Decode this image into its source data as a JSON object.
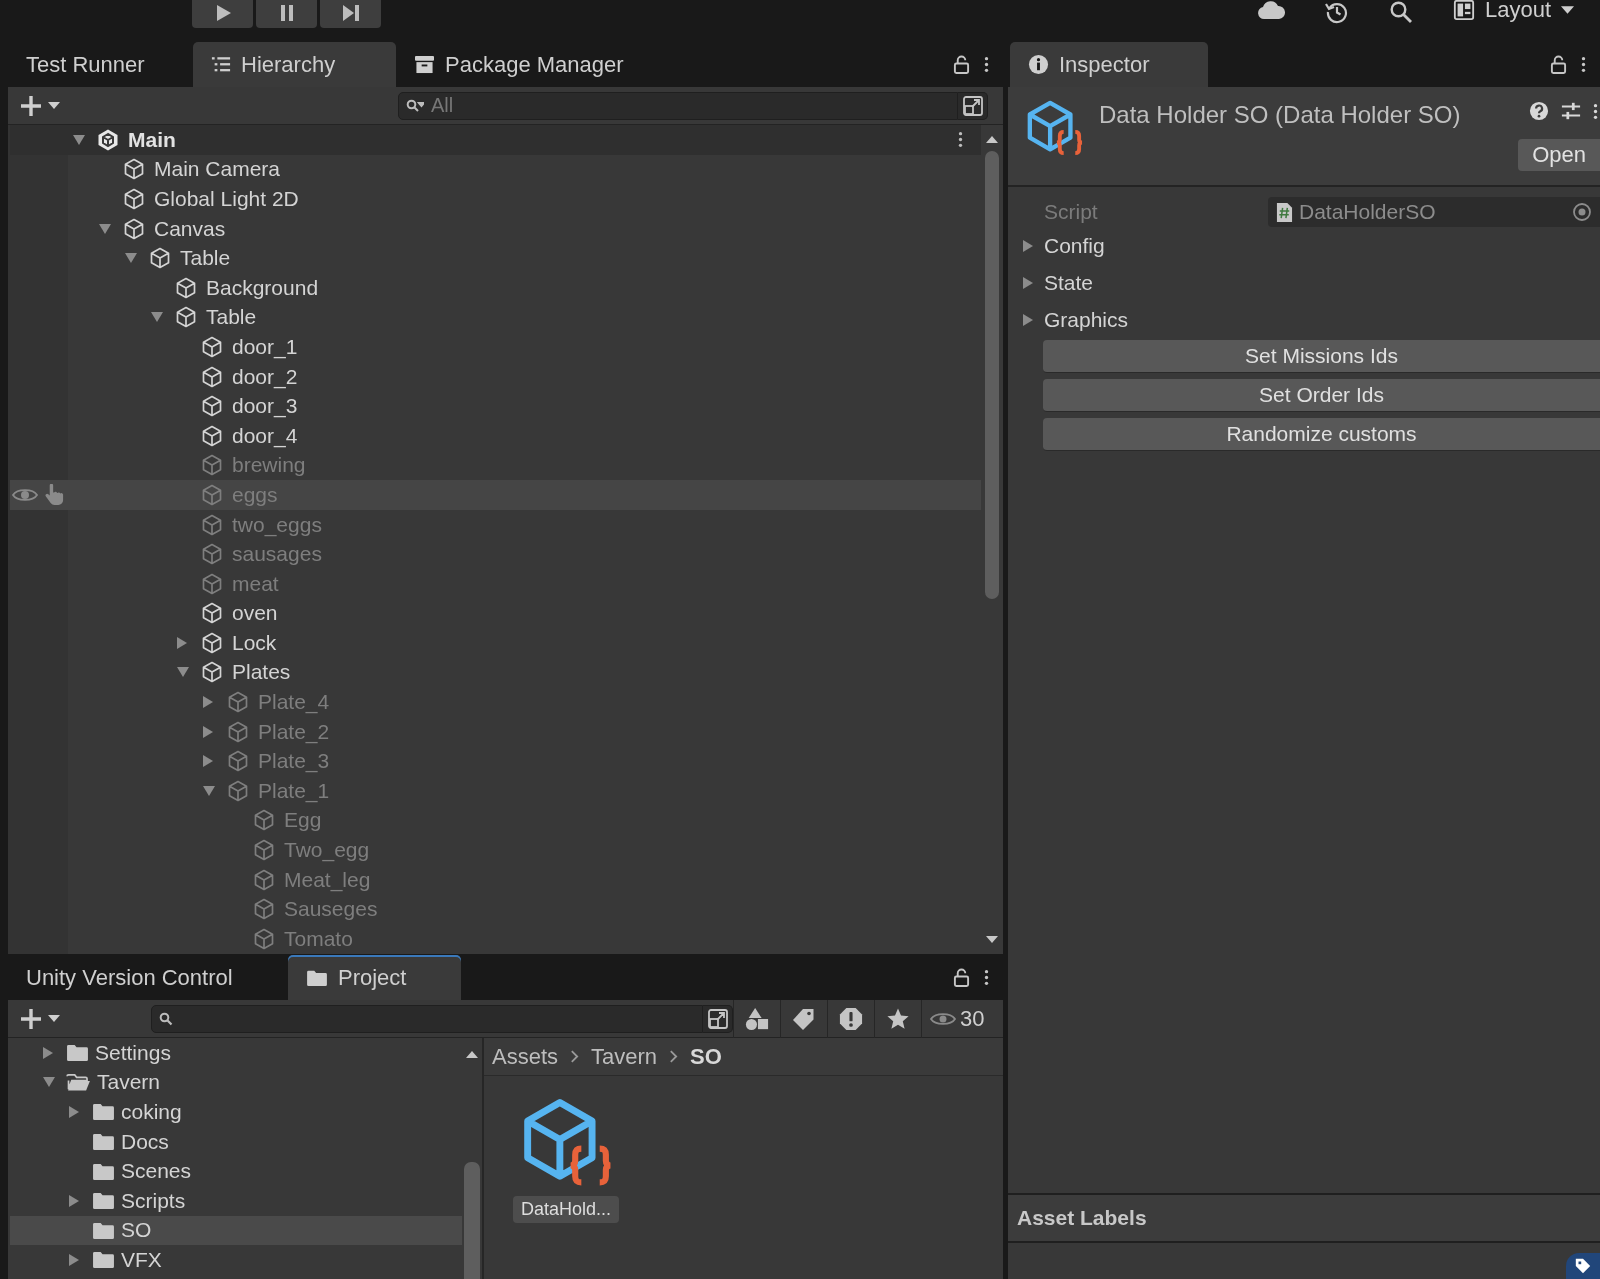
{
  "top_bar": {
    "layout_button": "Layout"
  },
  "hierarchy_panel": {
    "tabs": [
      {
        "label": "Test Runner",
        "kind": "plain",
        "selected": false
      },
      {
        "label": "Hierarchy",
        "kind": "hierarchy",
        "selected": true
      },
      {
        "label": "Package Manager",
        "kind": "package",
        "selected": false
      }
    ],
    "search": {
      "placeholder": "All"
    },
    "scene": {
      "name": "Main",
      "expanded": true,
      "items": [
        {
          "name": "Main Camera",
          "active": true,
          "highlighted": false
        },
        {
          "name": "Global Light 2D",
          "active": true,
          "highlighted": false
        },
        {
          "name": "Canvas",
          "active": true,
          "highlighted": false,
          "expanded": true,
          "children": [
            {
              "name": "Table",
              "active": true,
              "highlighted": false,
              "expanded": true,
              "children": [
                {
                  "name": "Background",
                  "active": true,
                  "highlighted": false
                },
                {
                  "name": "Table",
                  "active": true,
                  "highlighted": false,
                  "expanded": true,
                  "children": [
                    {
                      "name": "door_1",
                      "active": true,
                      "highlighted": false
                    },
                    {
                      "name": "door_2",
                      "active": true,
                      "highlighted": false
                    },
                    {
                      "name": "door_3",
                      "active": true,
                      "highlighted": false
                    },
                    {
                      "name": "door_4",
                      "active": true,
                      "highlighted": false
                    },
                    {
                      "name": "brewing",
                      "active": false,
                      "highlighted": false
                    },
                    {
                      "name": "eggs",
                      "active": false,
                      "highlighted": true
                    },
                    {
                      "name": "two_eggs",
                      "active": false,
                      "highlighted": false
                    },
                    {
                      "name": "sausages",
                      "active": false,
                      "highlighted": false
                    },
                    {
                      "name": "meat",
                      "active": false,
                      "highlighted": false
                    },
                    {
                      "name": "oven",
                      "active": true,
                      "highlighted": false
                    },
                    {
                      "name": "Lock",
                      "active": true,
                      "highlighted": false,
                      "expanded": false
                    },
                    {
                      "name": "Plates",
                      "active": true,
                      "highlighted": false,
                      "expanded": true,
                      "children": [
                        {
                          "name": "Plate_4",
                          "active": false,
                          "highlighted": false,
                          "expanded": false
                        },
                        {
                          "name": "Plate_2",
                          "active": false,
                          "highlighted": false,
                          "expanded": false
                        },
                        {
                          "name": "Plate_3",
                          "active": false,
                          "highlighted": false,
                          "expanded": false
                        },
                        {
                          "name": "Plate_1",
                          "active": false,
                          "highlighted": false,
                          "expanded": true,
                          "children": [
                            {
                              "name": "Egg",
                              "active": false,
                              "highlighted": false
                            },
                            {
                              "name": "Two_egg",
                              "active": false,
                              "highlighted": false
                            },
                            {
                              "name": "Meat_leg",
                              "active": false,
                              "highlighted": false
                            },
                            {
                              "name": "Sauseges",
                              "active": false,
                              "highlighted": false
                            },
                            {
                              "name": "Tomato",
                              "active": false,
                              "highlighted": false
                            }
                          ]
                        }
                      ]
                    }
                  ]
                }
              ]
            }
          ]
        }
      ]
    }
  },
  "project_panel": {
    "tabs": [
      {
        "label": "Unity Version Control",
        "kind": "plain",
        "selected": false
      },
      {
        "label": "Project",
        "kind": "folder",
        "selected": true
      }
    ],
    "hidden_count": "30",
    "folders": [
      {
        "name": "Settings",
        "expanded": false,
        "selected": false
      },
      {
        "name": "Tavern",
        "expanded": true,
        "selected": false,
        "children": [
          {
            "name": "coking",
            "expanded": false,
            "selected": false
          },
          {
            "name": "Docs",
            "selected": false
          },
          {
            "name": "Scenes",
            "selected": false
          },
          {
            "name": "Scripts",
            "expanded": false,
            "selected": false
          },
          {
            "name": "SO",
            "selected": true
          },
          {
            "name": "VFX",
            "expanded": false,
            "selected": false
          }
        ]
      }
    ],
    "breadcrumb": [
      "Assets",
      "Tavern",
      "SO"
    ],
    "assets": [
      {
        "label": "DataHold..."
      }
    ]
  },
  "inspector": {
    "tab": {
      "label": "Inspector",
      "kind": "info",
      "selected": true
    },
    "title": "Data Holder SO (Data Holder SO)",
    "open_button": "Open",
    "script": {
      "label": "Script",
      "value": "DataHolderSO"
    },
    "foldouts": [
      {
        "label": "Config",
        "expanded": false
      },
      {
        "label": "State",
        "expanded": false
      },
      {
        "label": "Graphics",
        "expanded": false
      }
    ],
    "buttons": [
      "Set Missions Ids",
      "Set Order Ids",
      "Randomize customs"
    ],
    "asset_labels": "Asset Labels"
  }
}
